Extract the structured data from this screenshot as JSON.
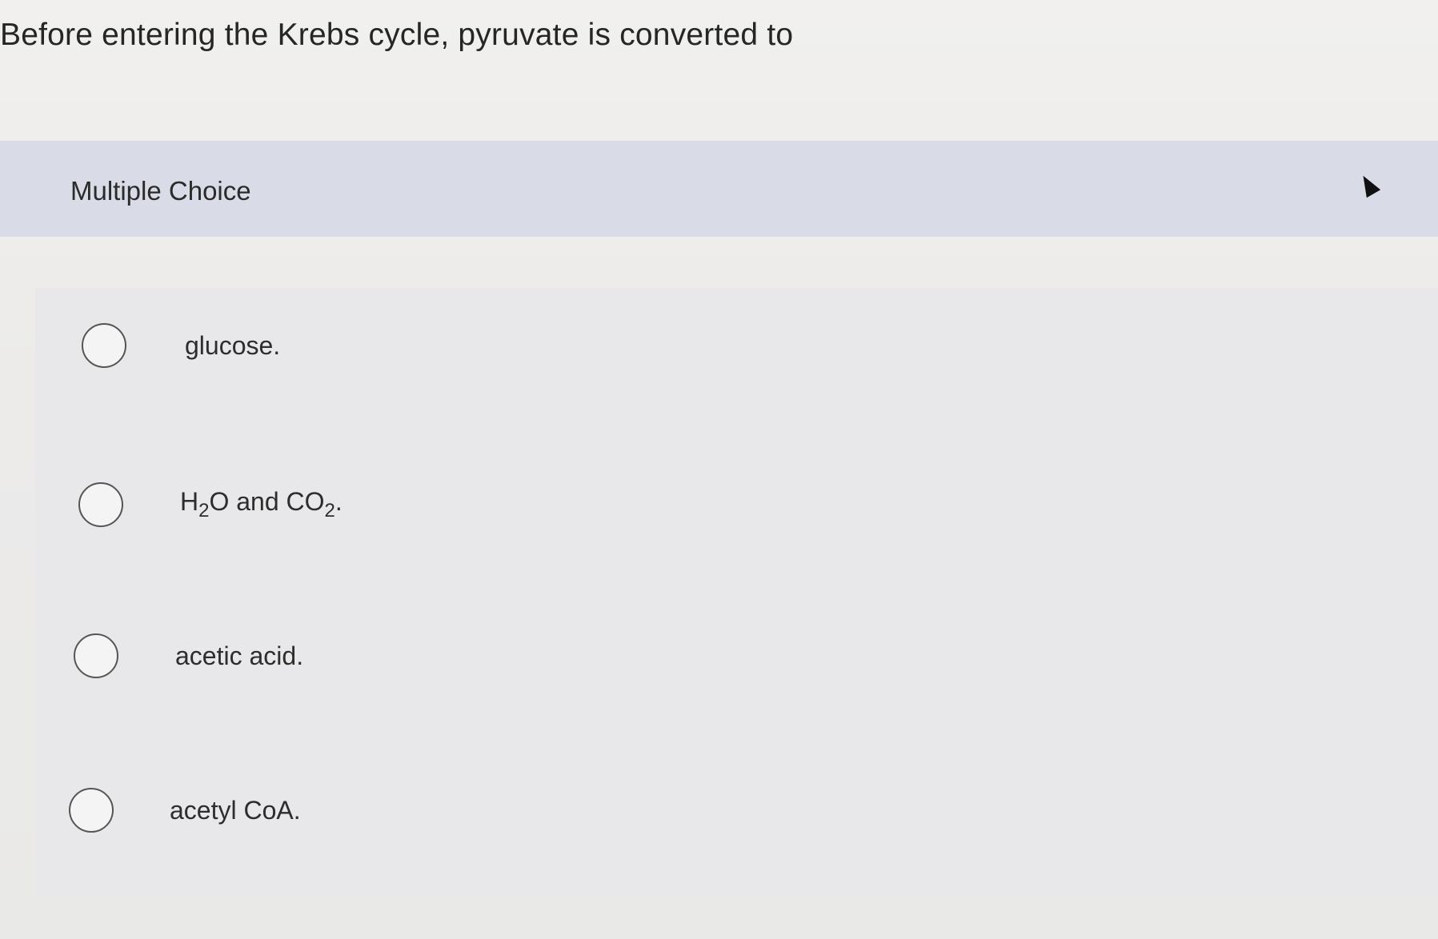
{
  "question": {
    "text": "Before entering the Krebs cycle, pyruvate is converted to"
  },
  "section": {
    "label": "Multiple Choice"
  },
  "options": [
    {
      "text": "glucose."
    },
    {
      "h": "H",
      "two_a": "2",
      "mid": "O and CO",
      "two_b": "2",
      "end": "."
    },
    {
      "text": "acetic acid."
    },
    {
      "text": "acetyl CoA."
    }
  ],
  "icons": {
    "radio": "radio-circle-icon",
    "cursor": "mouse-pointer-icon"
  },
  "colors": {
    "header_band": "#d9dbe6",
    "background": "#eeeeec",
    "text": "#2a2a2a"
  }
}
